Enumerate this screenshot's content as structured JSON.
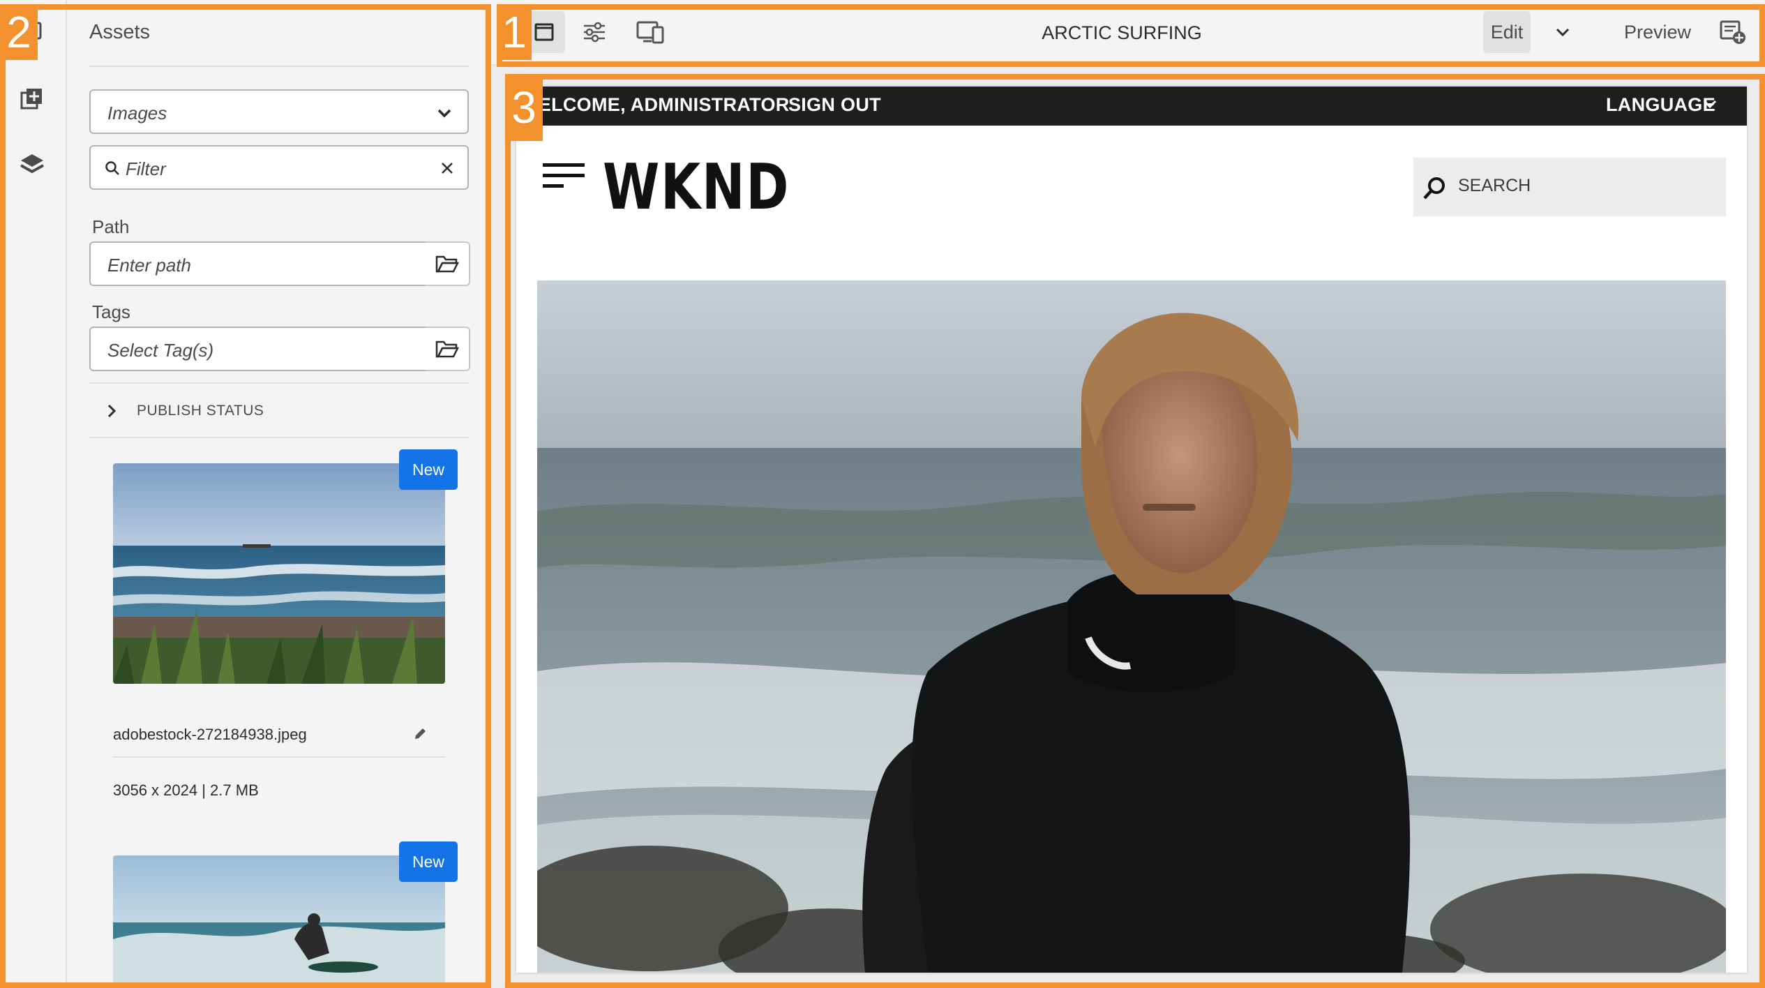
{
  "toolbar": {
    "page_title": "ARCTIC SURFING",
    "edit_label": "Edit",
    "preview_label": "Preview"
  },
  "panel": {
    "title": "Assets",
    "asset_type": "Images",
    "filter_placeholder": "Filter",
    "path_label": "Path",
    "path_placeholder": "Enter path",
    "tags_label": "Tags",
    "tags_placeholder": "Select Tag(s)",
    "publish_status_label": "PUBLISH STATUS",
    "assets": [
      {
        "badge": "New",
        "name": "adobestock-272184938.jpeg",
        "meta": "3056 x 2024 | 2.7 MB"
      },
      {
        "badge": "New"
      }
    ]
  },
  "site": {
    "welcome": "WELCOME, ADMINISTRATOR",
    "sign_out": "SIGN OUT",
    "language": "LANGUAGE",
    "logo": "WKND",
    "search_placeholder": "SEARCH"
  },
  "callouts": [
    "1",
    "2",
    "3"
  ],
  "colors": {
    "callout": "#f2912d",
    "badge": "#1473e6",
    "site_topbar": "#1e1e1e"
  }
}
